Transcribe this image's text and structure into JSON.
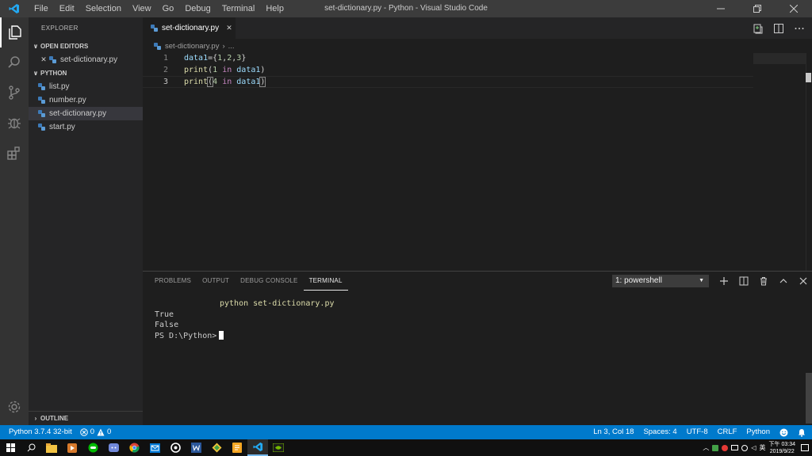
{
  "window": {
    "title": "set-dictionary.py - Python - Visual Studio Code",
    "menu": [
      "File",
      "Edit",
      "Selection",
      "View",
      "Go",
      "Debug",
      "Terminal",
      "Help"
    ]
  },
  "sidebar": {
    "header": "EXPLORER",
    "open_editors_label": "OPEN EDITORS",
    "open_editor_file": "set-dictionary.py",
    "folder_label": "PYTHON",
    "files": [
      "list.py",
      "number.py",
      "set-dictionary.py",
      "start.py"
    ],
    "selected_file": "set-dictionary.py",
    "outline_label": "OUTLINE"
  },
  "editor": {
    "tab_label": "set-dictionary.py",
    "breadcrumb_file": "set-dictionary.py",
    "breadcrumb_more": "...",
    "active_line": 3,
    "lines": [
      {
        "num": "1",
        "text": "data1={1,2,3}"
      },
      {
        "num": "2",
        "text": "print(1 in data1)"
      },
      {
        "num": "3",
        "text": "print(4 in data1)"
      }
    ]
  },
  "panel": {
    "tabs": [
      "PROBLEMS",
      "OUTPUT",
      "DEBUG CONSOLE",
      "TERMINAL"
    ],
    "active_tab": "TERMINAL",
    "terminal_select": "1: powershell",
    "terminal_lines": {
      "command": "python set-dictionary.py",
      "out1": "True",
      "out2": "False",
      "prompt": "PS D:\\Python>"
    }
  },
  "statusbar": {
    "interpreter": "Python 3.7.4 32-bit",
    "errors": "0",
    "warnings": "0",
    "cursor_position": "Ln 3, Col 18",
    "indentation": "Spaces: 4",
    "encoding": "UTF-8",
    "line_ending": "CRLF",
    "language": "Python"
  },
  "taskbar": {
    "time": "下午 03:34",
    "date": "2019/9/22",
    "ime": "英"
  },
  "colors": {
    "accent": "#007acc",
    "titlebar": "#3c3c3c",
    "activitybar": "#333333",
    "sidebar": "#252526",
    "editor": "#1e1e1e"
  }
}
